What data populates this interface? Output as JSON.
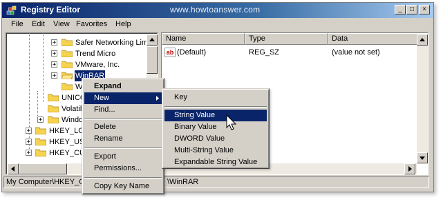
{
  "window": {
    "title": "Registry Editor",
    "watermark": "www.howtoanswer.com",
    "controls": {
      "minimize": "_",
      "maximize": "□",
      "close": "×"
    }
  },
  "menubar": [
    "File",
    "Edit",
    "View",
    "Favorites",
    "Help"
  ],
  "tree": {
    "items": [
      {
        "label": "Safer Networking Lim"
      },
      {
        "label": "Trend Micro"
      },
      {
        "label": "VMware, Inc."
      },
      {
        "label": "WinRAR",
        "selected": true
      },
      {
        "label": "W"
      },
      {
        "label": "UNICO"
      },
      {
        "label": "Volatil"
      },
      {
        "label": "Windo"
      },
      {
        "label": "HKEY_LOC"
      },
      {
        "label": "HKEY_USE"
      },
      {
        "label": "HKEY_CU"
      }
    ],
    "expander_plus": "+"
  },
  "list": {
    "columns": [
      "Name",
      "Type",
      "Data"
    ],
    "rows": [
      {
        "name": "(Default)",
        "type": "REG_SZ",
        "data": "(value not set)",
        "icon": "ab"
      }
    ]
  },
  "statusbar": {
    "left": "My Computer\\HKEY_C",
    "right": "\\WinRAR"
  },
  "context_menu": {
    "items": [
      "Expand",
      "New",
      "Find...",
      "Delete",
      "Rename",
      "Export",
      "Permissions...",
      "Copy Key Name"
    ],
    "highlighted": "New"
  },
  "submenu": {
    "items": [
      "Key",
      "String Value",
      "Binary Value",
      "DWORD Value",
      "Multi-String Value",
      "Expandable String Value"
    ],
    "highlighted": "String Value"
  },
  "colors": {
    "highlight": "#0a246a",
    "face": "#d4d0c8",
    "folder": "#f6d34f"
  }
}
